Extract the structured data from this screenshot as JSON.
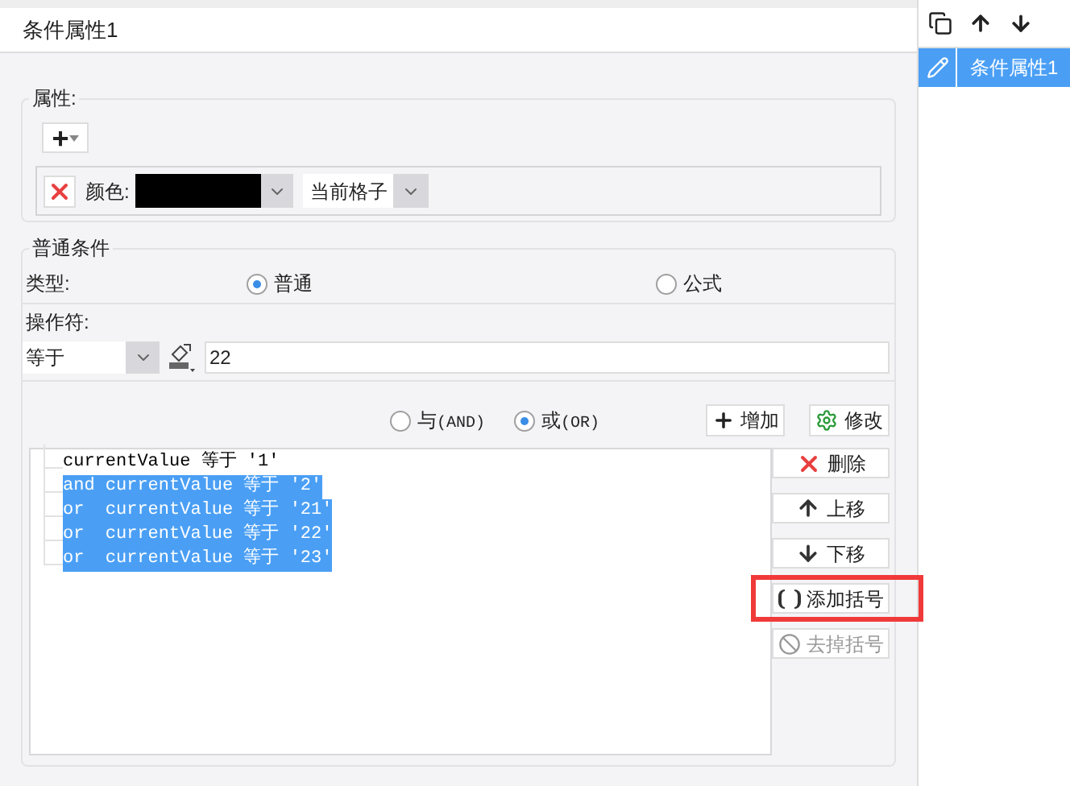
{
  "window": {
    "title": "条件属性1"
  },
  "attributes": {
    "legend": "属性:",
    "add_icon": "+",
    "rule": {
      "label": "颜色:",
      "color": "#000000",
      "scope": "当前格子"
    }
  },
  "condition": {
    "legend": "普通条件",
    "type_label": "类型:",
    "types": [
      {
        "label": "普通",
        "selected": true
      },
      {
        "label": "公式",
        "selected": false
      }
    ],
    "operator_label": "操作符:",
    "operator": "等于",
    "value": "22",
    "joins": [
      {
        "label": "与",
        "suffix": "(AND)",
        "selected": false
      },
      {
        "label": "或",
        "suffix": "(OR)",
        "selected": true
      }
    ],
    "add_button": "增加",
    "edit_button": "修改",
    "rows": [
      {
        "text": "currentValue 等于 '1'",
        "selected": false
      },
      {
        "text": "and currentValue 等于 '2'",
        "selected": true
      },
      {
        "text": "or  currentValue 等于 '21'",
        "selected": true
      },
      {
        "text": "or  currentValue 等于 '22'",
        "selected": true
      },
      {
        "text": "or  currentValue 等于 '23'",
        "selected": true
      }
    ],
    "actions": [
      {
        "kind": "delete",
        "label": "删除",
        "disabled": false,
        "highlighted": false
      },
      {
        "kind": "up",
        "label": "上移",
        "disabled": false,
        "highlighted": false
      },
      {
        "kind": "down",
        "label": "下移",
        "disabled": false,
        "highlighted": false
      },
      {
        "kind": "add-brackets",
        "label": "添加括号",
        "disabled": false,
        "highlighted": true
      },
      {
        "kind": "remove-brackets",
        "label": "去掉括号",
        "disabled": true,
        "highlighted": false
      }
    ]
  },
  "sidebar": {
    "items": [
      {
        "label": "条件属性1",
        "selected": true
      }
    ]
  }
}
